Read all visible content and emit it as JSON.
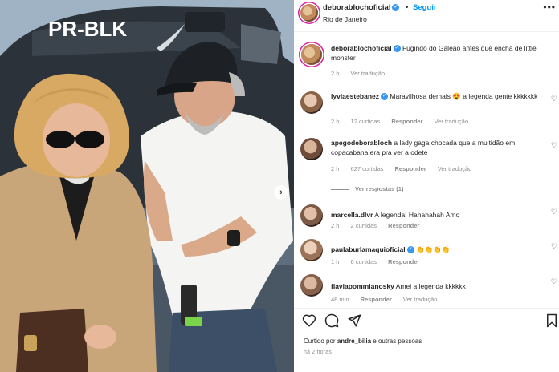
{
  "photo": {
    "helicopter_registration": "PR-BLK"
  },
  "header": {
    "username": "deborablochoficial",
    "follow_label": "Seguir",
    "location": "Rio de Janeiro"
  },
  "caption": {
    "username": "deborablochoficial",
    "text": "Fugindo do Galeão antes que encha de little monster",
    "time": "2 h",
    "translate": "Ver tradução"
  },
  "comments": [
    {
      "username": "lyviaestebanez",
      "text": "Maravilhosa demais 😍 a legenda gente kkkkkkk",
      "time": "2 h",
      "likes": "12 curtidas",
      "reply": "Responder",
      "translate": "Ver tradução"
    },
    {
      "username": "apegodeborabloch",
      "text": "a lady gaga chocada que a multidão em copacabana era pra ver a odete",
      "time": "2 h",
      "likes": "627 curtidas",
      "reply": "Responder",
      "translate": "Ver tradução"
    },
    {
      "username": "marcella.dlvr",
      "text": "A legenda! Hahahahah Amo",
      "time": "2 h",
      "likes": "2 curtidas",
      "reply": "Responder",
      "translate": ""
    },
    {
      "username": "paulaburlamaquioficial",
      "text": "👏👏👏👏",
      "time": "1 h",
      "likes": "6 curtidas",
      "reply": "Responder",
      "translate": ""
    },
    {
      "username": "flaviapommianosky",
      "text": "Amei a legenda kkkkkk",
      "time": "48 min",
      "likes": "",
      "reply": "Responder",
      "translate": "Ver tradução"
    }
  ],
  "view_replies": "Ver respostas (1)",
  "footer": {
    "liked_prefix": "Curtido por",
    "liked_user": "andre_bilia",
    "liked_suffix": "e outras pessoas",
    "time": "há 2 horas"
  },
  "colors": {
    "accent": "#0095f6",
    "verified": "#3897f0",
    "muted": "#8e8e8e"
  },
  "icons": [
    "heart-icon",
    "comment-icon",
    "share-icon",
    "bookmark-icon",
    "more-icon",
    "verified-icon"
  ]
}
